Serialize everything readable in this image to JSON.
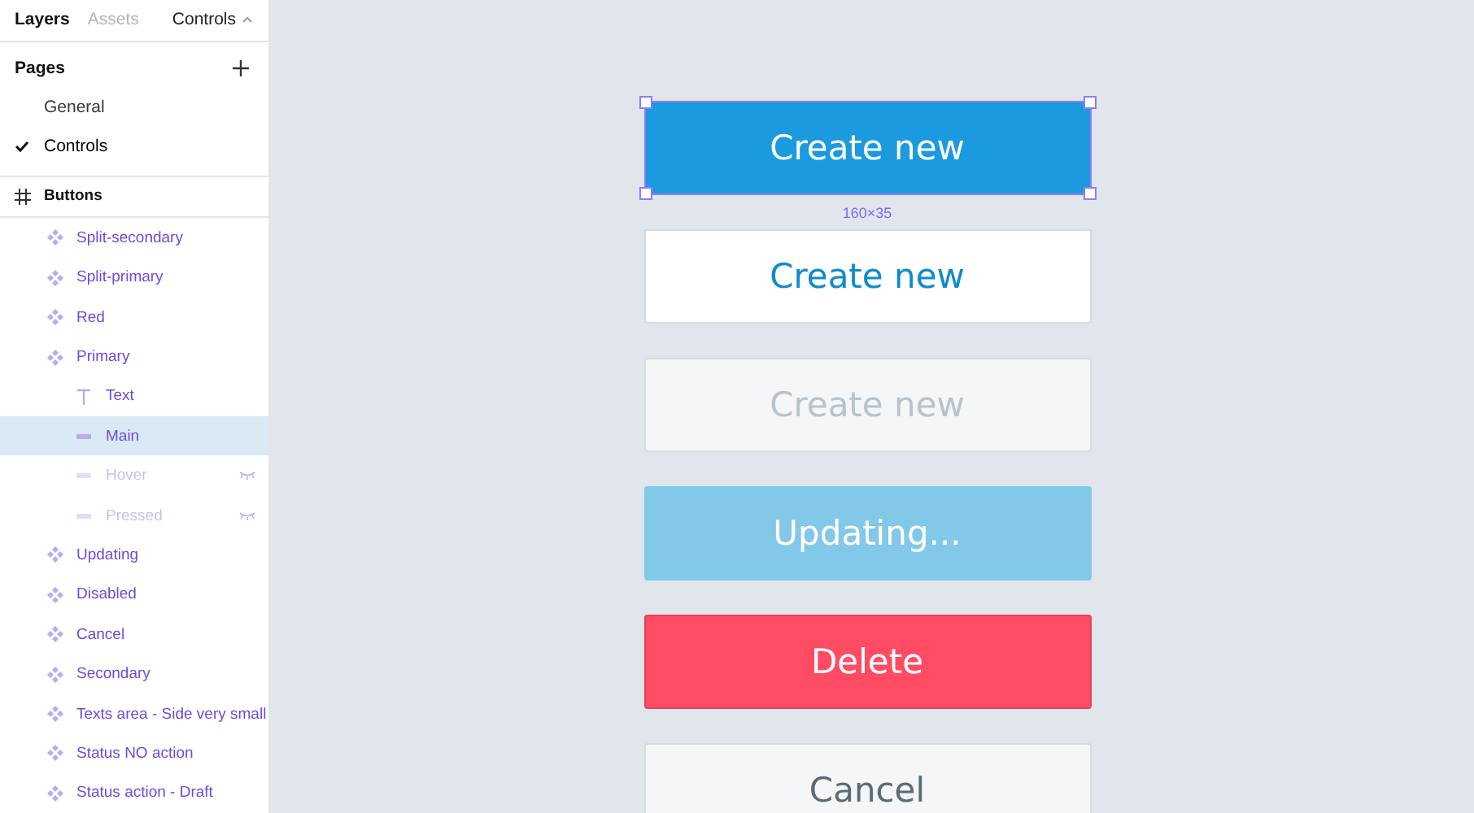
{
  "sidebar": {
    "tabs": [
      {
        "label": "Layers",
        "selected": true
      },
      {
        "label": "Assets",
        "selected": false
      }
    ],
    "page_menu": "Controls",
    "pages_title": "Pages",
    "pages": [
      {
        "label": "General",
        "selected": false
      },
      {
        "label": "Controls",
        "selected": true
      }
    ],
    "layers": [
      {
        "label": "Buttons",
        "kind": "frame",
        "selected": false,
        "hidden": false,
        "children": [
          {
            "label": "Split-secondary",
            "kind": "component",
            "selected": false,
            "hidden": false
          },
          {
            "label": "Split-primary",
            "kind": "component",
            "selected": false,
            "hidden": false
          },
          {
            "label": "Red",
            "kind": "component",
            "selected": false,
            "hidden": false
          },
          {
            "label": "Primary",
            "kind": "component",
            "selected": false,
            "hidden": false,
            "children": [
              {
                "label": "Text",
                "kind": "text",
                "selected": false,
                "hidden": false
              },
              {
                "label": "Main",
                "kind": "rect",
                "selected": true,
                "hidden": false
              },
              {
                "label": "Hover",
                "kind": "rect",
                "selected": false,
                "hidden": true
              },
              {
                "label": "Pressed",
                "kind": "rect",
                "selected": false,
                "hidden": true
              }
            ]
          },
          {
            "label": "Updating",
            "kind": "component",
            "selected": false,
            "hidden": false
          },
          {
            "label": "Disabled",
            "kind": "component",
            "selected": false,
            "hidden": false
          },
          {
            "label": "Cancel",
            "kind": "component",
            "selected": false,
            "hidden": false
          },
          {
            "label": "Secondary",
            "kind": "component",
            "selected": false,
            "hidden": false
          },
          {
            "label": "Texts area - Side very small",
            "kind": "component",
            "selected": false,
            "hidden": false
          },
          {
            "label": "Status NO action",
            "kind": "component",
            "selected": false,
            "hidden": false
          },
          {
            "label": "Status action - Draft",
            "kind": "component",
            "selected": false,
            "hidden": false
          }
        ]
      }
    ]
  },
  "canvas": {
    "buttons": [
      {
        "label": "Create new",
        "kind": "primary",
        "selected": true,
        "size": "160×35"
      },
      {
        "label": "Create new",
        "kind": "secondary",
        "selected": false
      },
      {
        "label": "Create new",
        "kind": "disabled",
        "selected": false
      },
      {
        "label": "Updating...",
        "kind": "updating",
        "selected": false
      },
      {
        "label": "Delete",
        "kind": "danger",
        "selected": false
      },
      {
        "label": "Cancel",
        "kind": "cancel",
        "selected": false
      }
    ]
  }
}
